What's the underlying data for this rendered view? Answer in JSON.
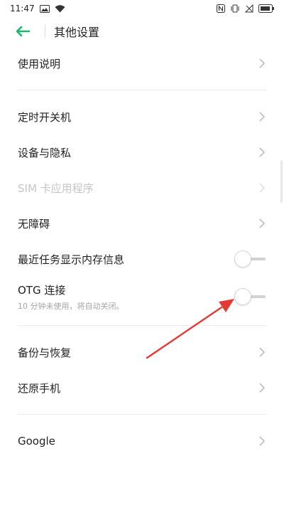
{
  "status_bar": {
    "time": "11:47"
  },
  "header": {
    "title": "其他设置"
  },
  "sections": {
    "first": [
      {
        "label": "使用说明"
      }
    ],
    "second": [
      {
        "label": "定时开关机"
      },
      {
        "label": "设备与隐私"
      },
      {
        "label": "SIM 卡应用程序",
        "disabled": true
      },
      {
        "label": "无障碍"
      },
      {
        "label": "最近任务显示内存信息",
        "toggle": false
      },
      {
        "label": "OTG 连接",
        "sub": "10 分钟未使用，将自动关闭。",
        "toggle": false
      }
    ],
    "third": [
      {
        "label": "备份与恢复"
      },
      {
        "label": "还原手机"
      }
    ],
    "fourth": [
      {
        "label": "Google"
      }
    ]
  },
  "colors": {
    "accent": "#1bb86a",
    "arrow": "#e53935"
  },
  "icons": [
    "back-arrow-icon",
    "chevron-right-icon",
    "nfc-icon",
    "vibrate-icon",
    "wifi-icon",
    "battery-icon",
    "image-icon"
  ]
}
